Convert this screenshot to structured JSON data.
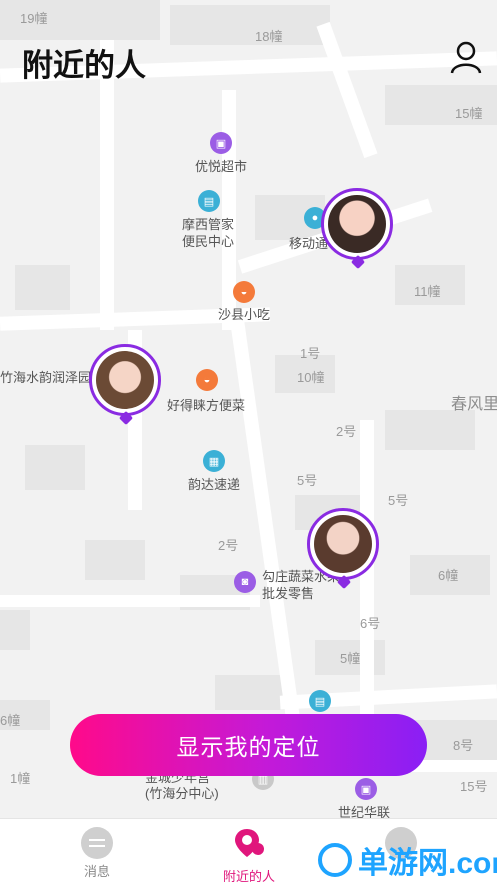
{
  "header": {
    "title": "附近的人",
    "profile_icon": "user-icon"
  },
  "map": {
    "area_labels": [
      "19幢",
      "18幢",
      "15幢",
      "11幢",
      "1号",
      "10幢",
      "春风里",
      "2号",
      "5号",
      "5号",
      "6幢",
      "2号",
      "6号",
      "5幢",
      "8号",
      "1幢",
      "15号",
      "6幢"
    ],
    "pois": [
      {
        "name": "优悦超市",
        "icon": "shop-icon",
        "color": "#9b5de5"
      },
      {
        "name": "摩西管家\n便民中心",
        "icon": "service-icon",
        "color": "#3bb0d6"
      },
      {
        "name": "移动通",
        "icon": "mobile-icon",
        "color": "#3bb0d6"
      },
      {
        "name": "沙县小吃",
        "icon": "food-icon",
        "color": "#f47a3a"
      },
      {
        "name": "竹海水韵润泽园",
        "icon": "",
        "color": ""
      },
      {
        "name": "好得睐方便菜",
        "icon": "food-icon",
        "color": "#f47a3a"
      },
      {
        "name": "韵达速递",
        "icon": "delivery-icon",
        "color": "#3bb0d6"
      },
      {
        "name": "勾庄蔬菜水果\n批发零售",
        "icon": "bag-icon",
        "color": "#9b5de5"
      },
      {
        "name": "世纪华联",
        "icon": "shop-icon",
        "color": "#9b5de5"
      },
      {
        "name": "金城少年宫\n(竹海分中心)",
        "icon": "bank-icon",
        "color": "#c9c9c9"
      }
    ]
  },
  "cta": {
    "label": "显示我的定位"
  },
  "tabs": [
    {
      "label": "消息",
      "icon": "message-icon",
      "active": false
    },
    {
      "label": "附近的人",
      "icon": "location-icon",
      "active": true
    },
    {
      "label": "",
      "icon": "circle-icon",
      "active": false
    }
  ],
  "watermark": {
    "text": "单游网.com"
  },
  "colors": {
    "accent_start": "#ff0a8a",
    "accent_end": "#8a1ff5",
    "pin_border": "#8a2be2"
  }
}
